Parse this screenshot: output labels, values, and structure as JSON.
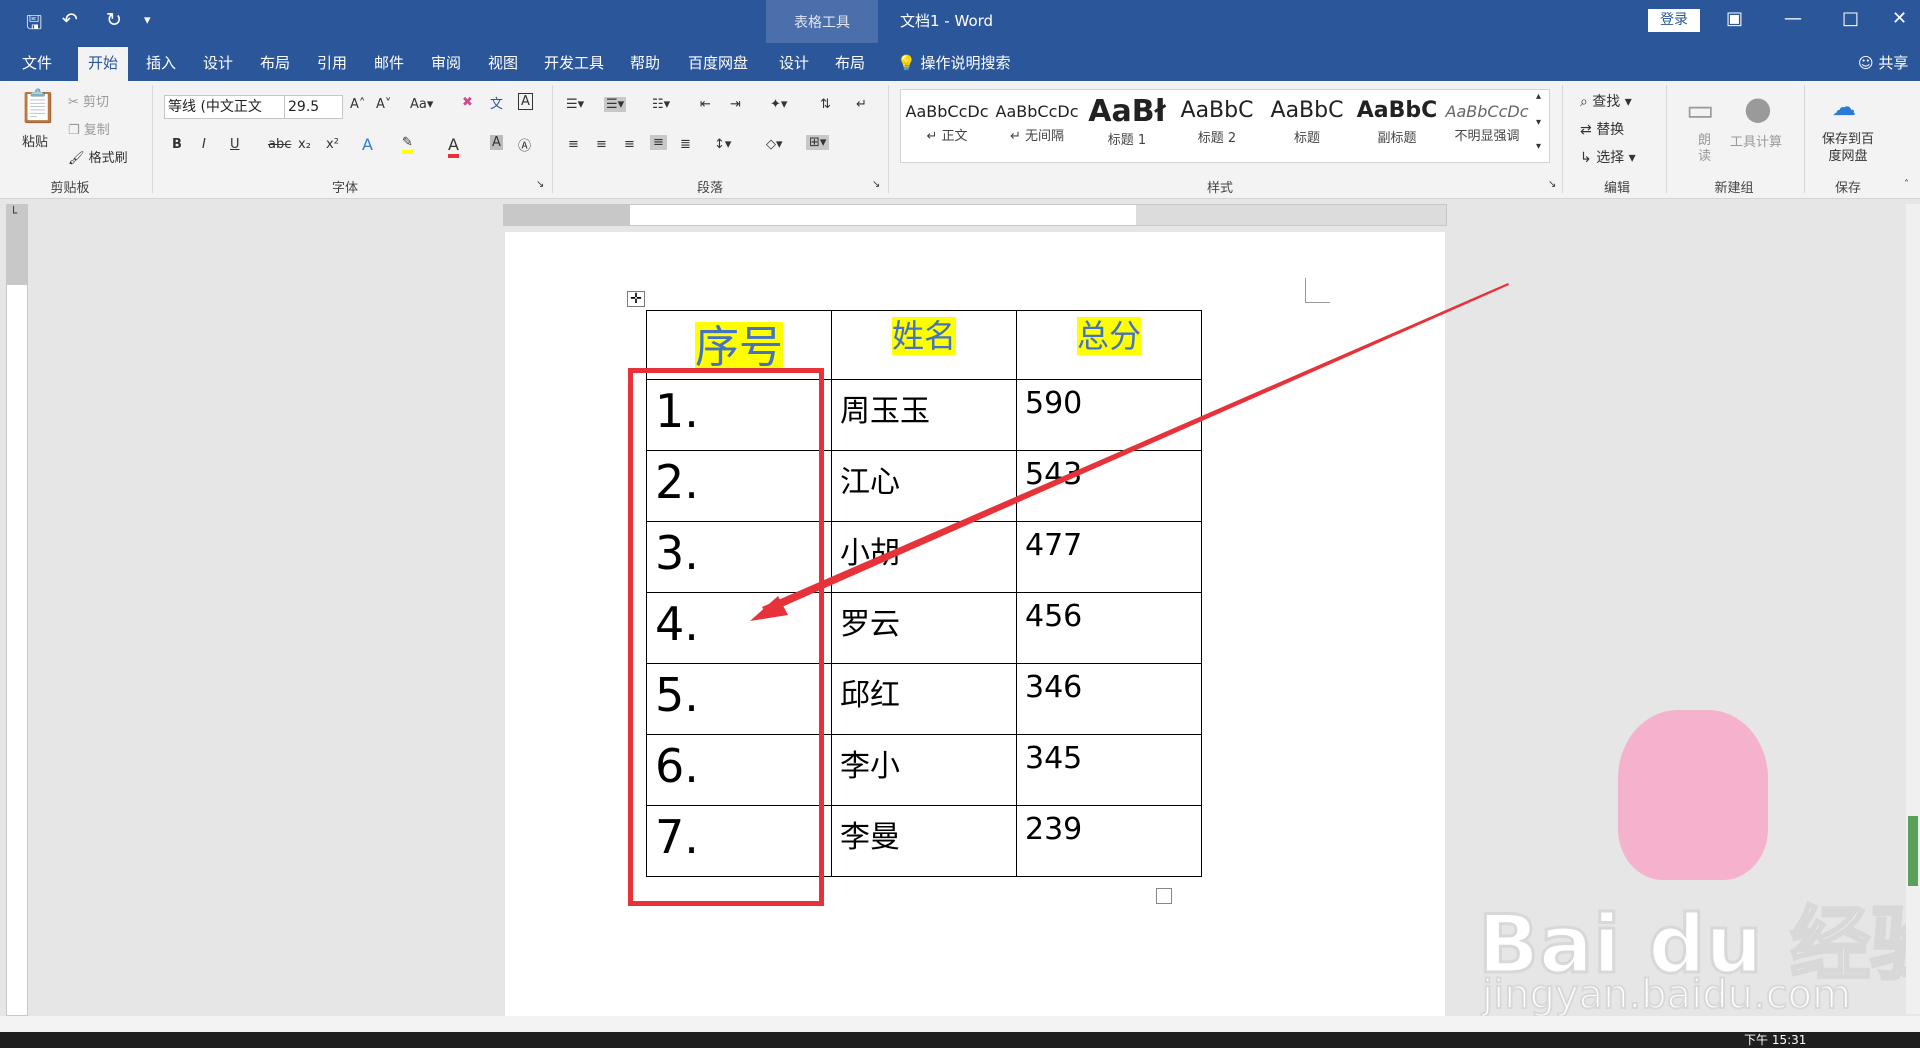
{
  "window": {
    "doc_title": "文档1 - Word",
    "context_tab_header": "表格工具",
    "login": "登录",
    "share": "共享",
    "search_tip": "操作说明搜索"
  },
  "tabs": [
    "文件",
    "开始",
    "插入",
    "设计",
    "布局",
    "引用",
    "邮件",
    "审阅",
    "视图",
    "开发工具",
    "帮助",
    "百度网盘",
    "设计",
    "布局"
  ],
  "active_tab": "开始",
  "ribbon": {
    "clipboard": {
      "paste": "粘贴",
      "cut": "剪切",
      "copy": "复制",
      "format_painter": "格式刷",
      "group": "剪贴板"
    },
    "font": {
      "name": "等线 (中文正文",
      "size": "29.5",
      "group": "字体"
    },
    "paragraph": {
      "group": "段落"
    },
    "styles": {
      "items": [
        {
          "preview": "AaBbCcDc",
          "name": "↵ 正文"
        },
        {
          "preview": "AaBbCcDc",
          "name": "↵ 无间隔"
        },
        {
          "preview": "AaBł",
          "name": "标题 1"
        },
        {
          "preview": "AaBbC",
          "name": "标题 2"
        },
        {
          "preview": "AaBbC",
          "name": "标题"
        },
        {
          "preview": "AaBbC",
          "name": "副标题"
        },
        {
          "preview": "AaBbCcDc",
          "name": "不明显强调"
        }
      ],
      "group": "样式"
    },
    "editing": {
      "find": "查找",
      "replace": "替换",
      "select": "选择",
      "group": "编辑"
    },
    "newgroup": {
      "read": "朗读",
      "tool": "工具计算",
      "group": "新建组"
    },
    "save": {
      "label": "保存到百度网盘",
      "group": "保存"
    }
  },
  "table": {
    "headers": [
      "序号",
      "姓名",
      "总分"
    ],
    "rows": [
      {
        "no": "1.",
        "name": "周玉玉",
        "score": "590"
      },
      {
        "no": "2.",
        "name": "江心",
        "score": "543"
      },
      {
        "no": "3.",
        "name": "小胡",
        "score": "477"
      },
      {
        "no": "4.",
        "name": "罗云",
        "score": "456"
      },
      {
        "no": "5.",
        "name": "邱红",
        "score": "346"
      },
      {
        "no": "6.",
        "name": "李小",
        "score": "345"
      },
      {
        "no": "7.",
        "name": "李曼",
        "score": "239"
      }
    ]
  },
  "watermark": {
    "brand": "Bai du 经验",
    "url": "jingyan.baidu.com"
  },
  "taskbar": {
    "time": "下午 15:31"
  },
  "colors": {
    "title_bar": "#2b579a",
    "highlight": "#ffff00",
    "header_text": "#4472c4",
    "annotation": "#e8323a"
  }
}
